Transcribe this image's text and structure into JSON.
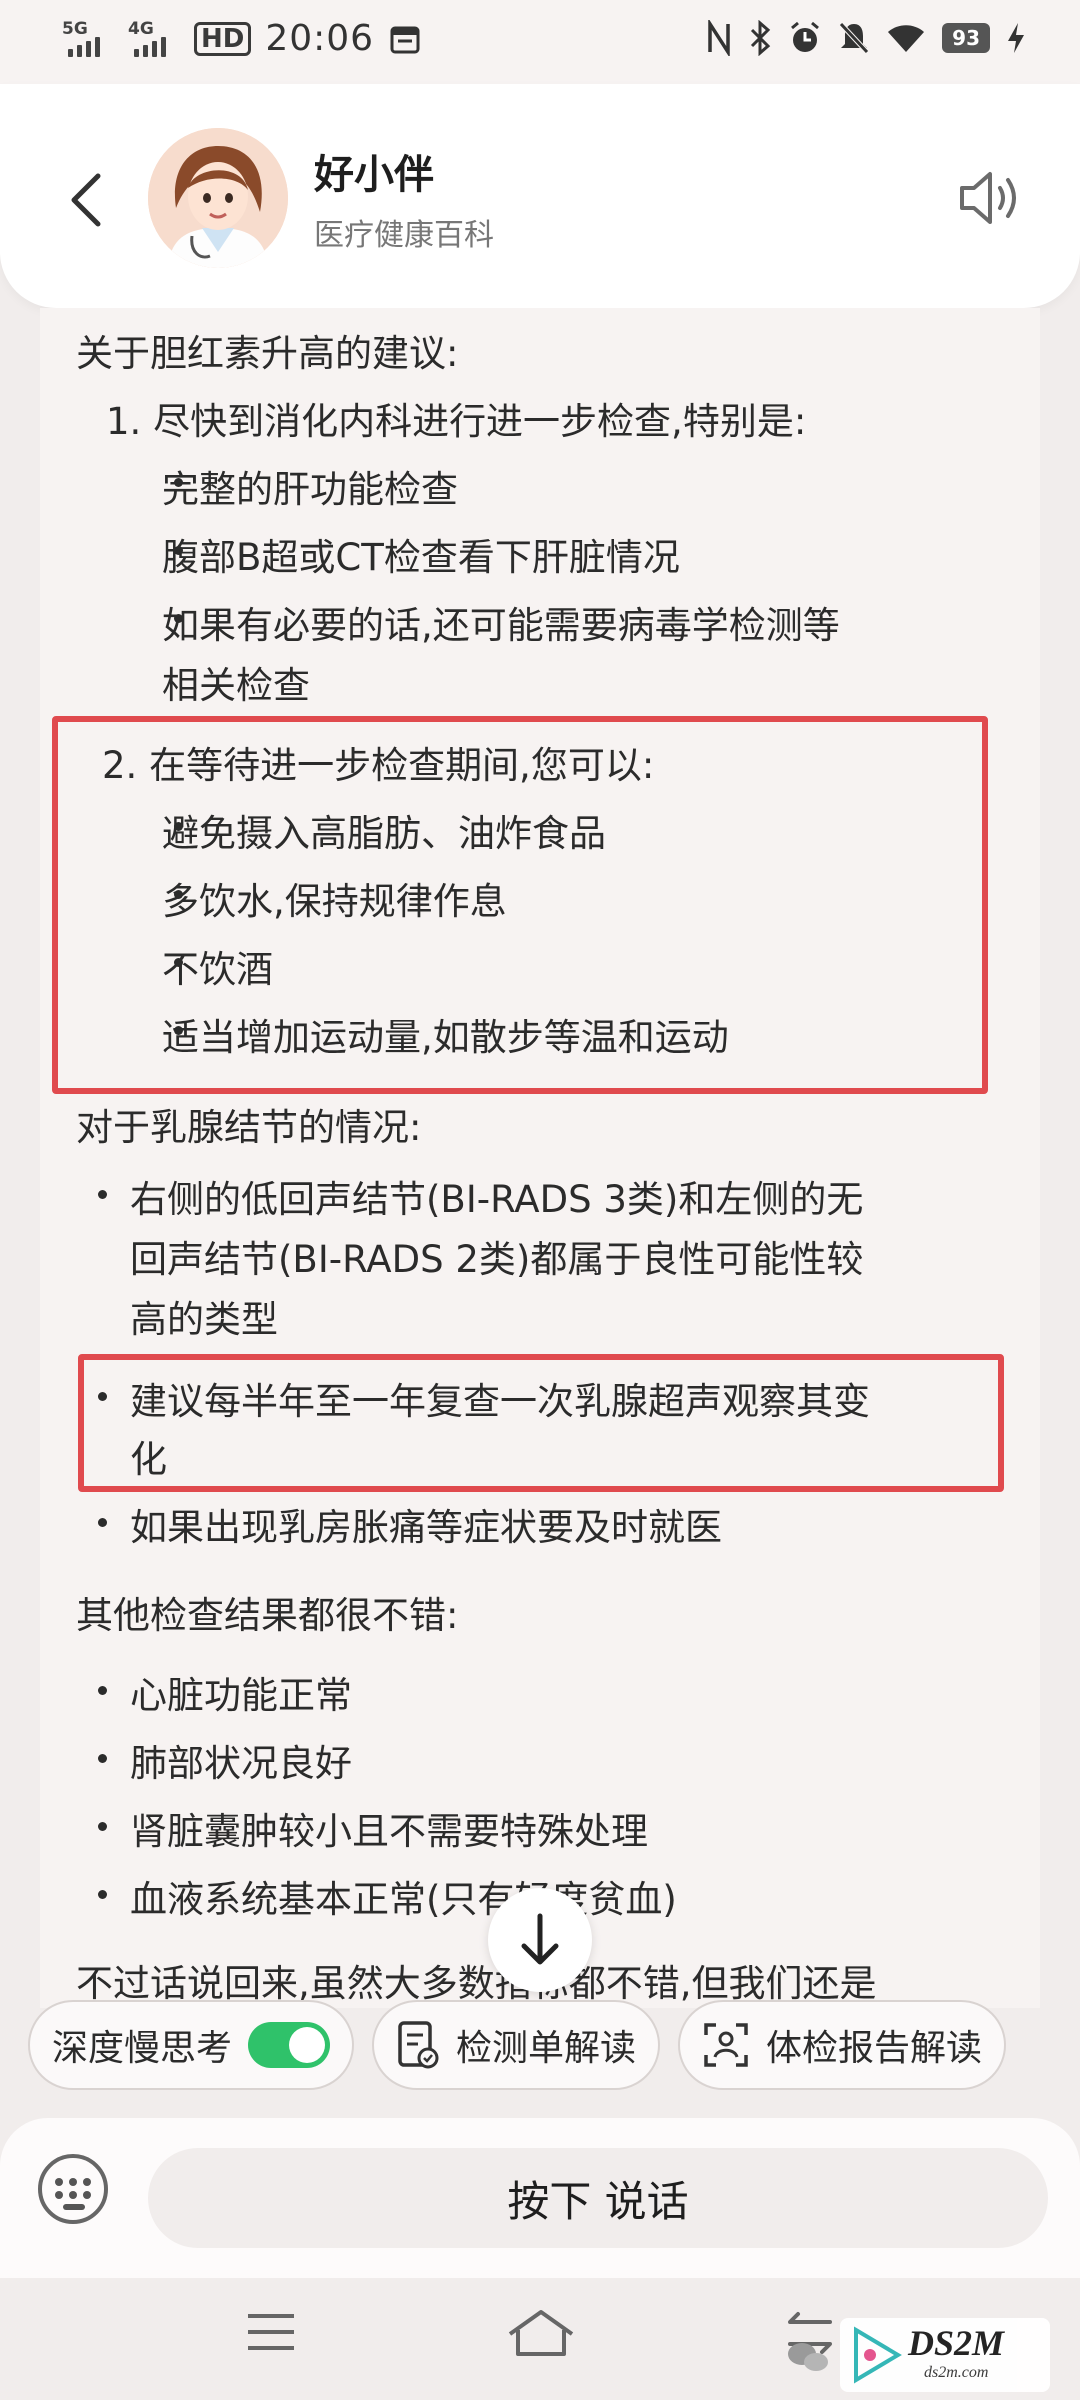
{
  "status_bar": {
    "signal1": "5G",
    "signal2": "4G",
    "hd": "HD",
    "time": "20:06",
    "battery": "93"
  },
  "header": {
    "title": "好小伴",
    "subtitle": "医疗健康百科"
  },
  "message": {
    "lines": [
      "关于胆红素升高的建议:",
      "1. 尽快到消化内科进行进一步检查,特别是:",
      "完整的肝功能检查",
      "腹部B超或CT检查看下肝脏情况",
      "如果有必要的话,还可能需要病毒学检测等",
      "相关检查",
      "2. 在等待进一步检查期间,您可以:",
      "避免摄入高脂肪、油炸食品",
      "多饮水,保持规律作息",
      "不饮酒",
      "适当增加运动量,如散步等温和运动",
      "对于乳腺结节的情况:",
      "右侧的低回声结节(BI-RADS 3类)和左侧的无",
      "回声结节(BI-RADS 2类)都属于良性可能性较",
      "高的类型",
      "建议每半年至一年复查一次乳腺超声观察其变",
      "化",
      "如果出现乳房胀痛等症状要及时就医",
      "其他检查结果都很不错:",
      "心脏功能正常",
      "肺部状况良好",
      "肾脏囊肿较小且不需要特殊处理",
      "血液系统基本正常(只有轻度贫血)",
      "不过话说回来,虽然大多数指标都不错,但我们还是"
    ]
  },
  "chips": {
    "deep_think": "深度慢思考",
    "deep_think_on": true,
    "lab_report": "检测单解读",
    "checkup_report": "体检报告解读"
  },
  "input": {
    "talk_label": "按下 说话"
  },
  "watermark": {
    "brand": "DS2M",
    "url": "ds2m.com"
  },
  "colors": {
    "highlight_box": "#e04a4e",
    "toggle_on": "#2fc26a"
  }
}
